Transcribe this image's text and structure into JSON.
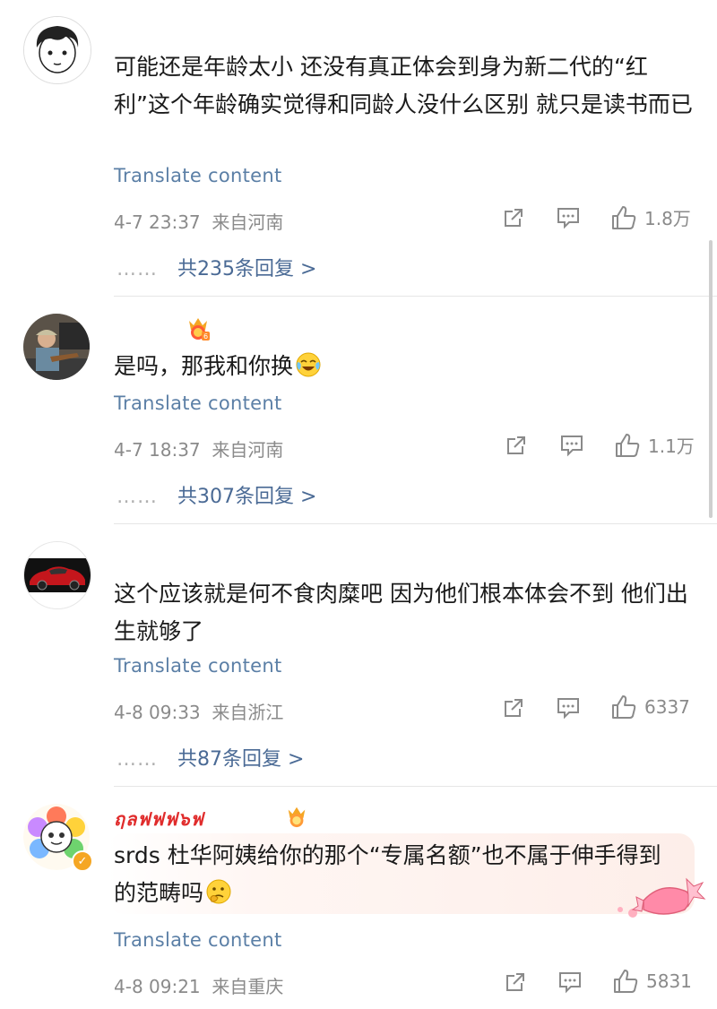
{
  "comments": [
    {
      "text": "可能还是年龄太小 还没有真正体会到身为新二代的“红利”这个年龄确实觉得和同龄人没什么区别 就只是读书而已",
      "translate": "Translate content",
      "time": "4-7 23:37",
      "location": "来自河南",
      "likes": "1.8万",
      "replies": "共235条回复 >",
      "avatar": "cartoon-boy-avatar"
    },
    {
      "text": "是吗，那我和你换",
      "emoji": "laughing-crying-emoji",
      "translate": "Translate content",
      "time": "4-7 18:37",
      "location": "来自河南",
      "likes": "1.1万",
      "replies": "共307条回复 >",
      "avatar": "photo-avatar-guitar"
    },
    {
      "text": "这个应该就是何不食肉糜吧 因为他们根本体会不到 他们出生就够了",
      "translate": "Translate content",
      "time": "4-8 09:33",
      "location": "来自浙江",
      "likes": "6337",
      "replies": "共87条回复 >",
      "avatar": "red-car-avatar"
    },
    {
      "nickname": "ฤลฟฟฟ๖ฟ",
      "text": "srds 杜华阿姨给你的那个“专属名额”也不属于伸手得到的范畴吗",
      "emoji": "thinking-emoji",
      "translate": "Translate content",
      "time": "4-8 09:21",
      "location": "来自重庆",
      "likes": "5831",
      "avatar": "flower-cartoon-avatar"
    }
  ],
  "reply_dots": "……",
  "colors": {
    "link": "#5b7fa6",
    "reply_link": "#4a6a95",
    "meta": "#8a8a8a",
    "vip": "#f5a623"
  }
}
